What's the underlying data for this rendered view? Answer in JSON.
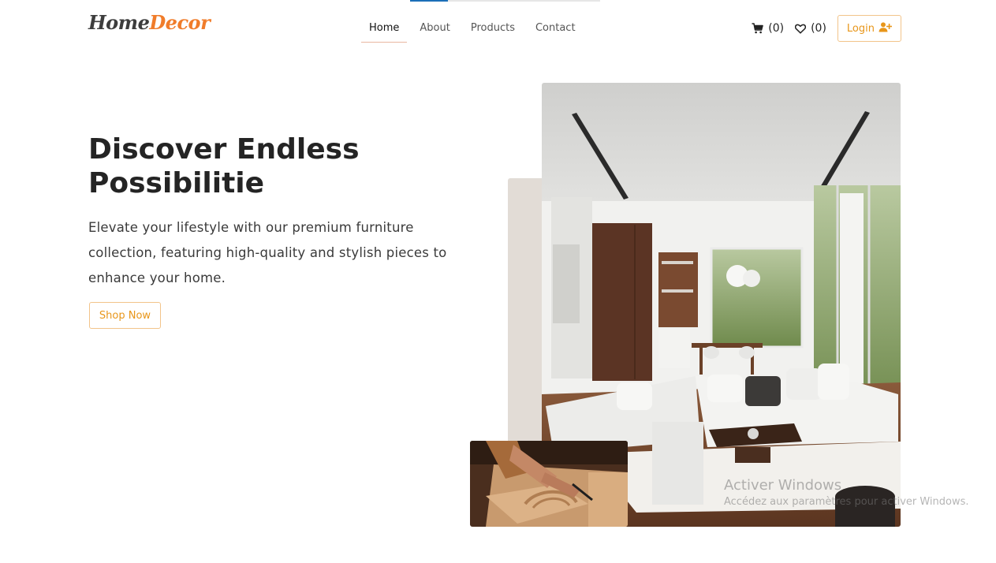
{
  "page_progress": 0.2,
  "brand": {
    "logo_part1": "Home",
    "logo_part2": "Decor",
    "accent_color": "#f07c2a"
  },
  "nav": {
    "items": [
      {
        "label": "Home",
        "active": true
      },
      {
        "label": "About"
      },
      {
        "label": "Products"
      },
      {
        "label": "Contact"
      }
    ]
  },
  "header_actions": {
    "cart_icon": "cart-icon",
    "cart_count": "(0)",
    "wishlist_icon": "heart-icon",
    "wishlist_count": "(0)",
    "login_label": "Login",
    "login_icon": "user-plus-icon",
    "button_color": "#e8961a"
  },
  "hero": {
    "title": "Discover Endless Possibilitie",
    "description": "Elevate your lifestyle with our premium furniture collection, featuring high-quality and stylish pieces to enhance your home.",
    "cta_label": "Shop Now"
  },
  "images": {
    "main": "living-room-photo",
    "small": "woodworking-photo"
  },
  "os_watermark": {
    "line1": "Activer Windows",
    "line2": "Accédez aux paramètres pour activer Windows."
  }
}
